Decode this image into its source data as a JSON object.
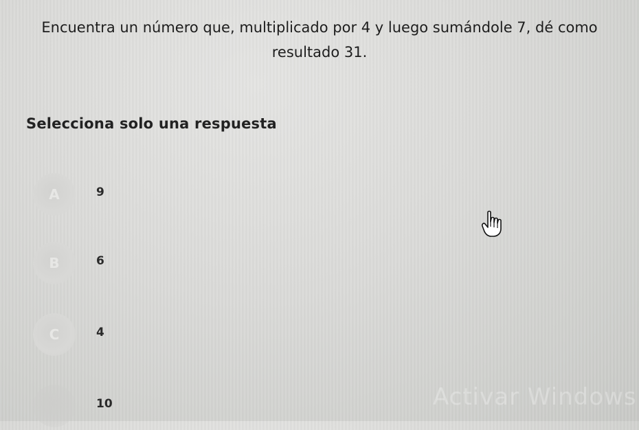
{
  "question": {
    "line1": "Encuentra un número que, multiplicado por 4 y luego sumándole 7, dé como",
    "line2": "resultado 31."
  },
  "instruction": "Selecciona solo una respuesta",
  "options": [
    {
      "letter": "A",
      "value": "9"
    },
    {
      "letter": "B",
      "value": "6"
    },
    {
      "letter": "C",
      "value": "4"
    },
    {
      "letter": "",
      "value": "10"
    }
  ],
  "watermark": "Activar Windows",
  "cursor_icon": "hand-pointer-icon"
}
